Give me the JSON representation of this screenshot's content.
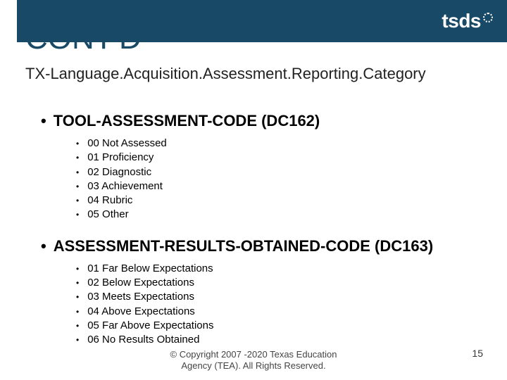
{
  "header": {
    "logo_text": "tsds",
    "title": "NEW CODE TABLES\nCONT'D"
  },
  "subtitle": "TX-Language.Acquisition.Assessment.Reporting.Category",
  "sections": [
    {
      "heading": "TOOL-ASSESSMENT-CODE (DC162)",
      "items": [
        "00 Not Assessed",
        "01 Proficiency",
        "02 Diagnostic",
        "03 Achievement",
        "04 Rubric",
        "05 Other"
      ]
    },
    {
      "heading": "ASSESSMENT-RESULTS-OBTAINED-CODE (DC163)",
      "items": [
        "01 Far Below Expectations",
        "02 Below Expectations",
        "03 Meets Expectations",
        "04 Above Expectations",
        "05 Far Above Expectations",
        "06 No Results Obtained"
      ]
    }
  ],
  "footer": {
    "copyright_line1": "© Copyright 2007 -2020 Texas Education",
    "copyright_line2": "Agency (TEA). All Rights Reserved.",
    "page_number": "15"
  }
}
